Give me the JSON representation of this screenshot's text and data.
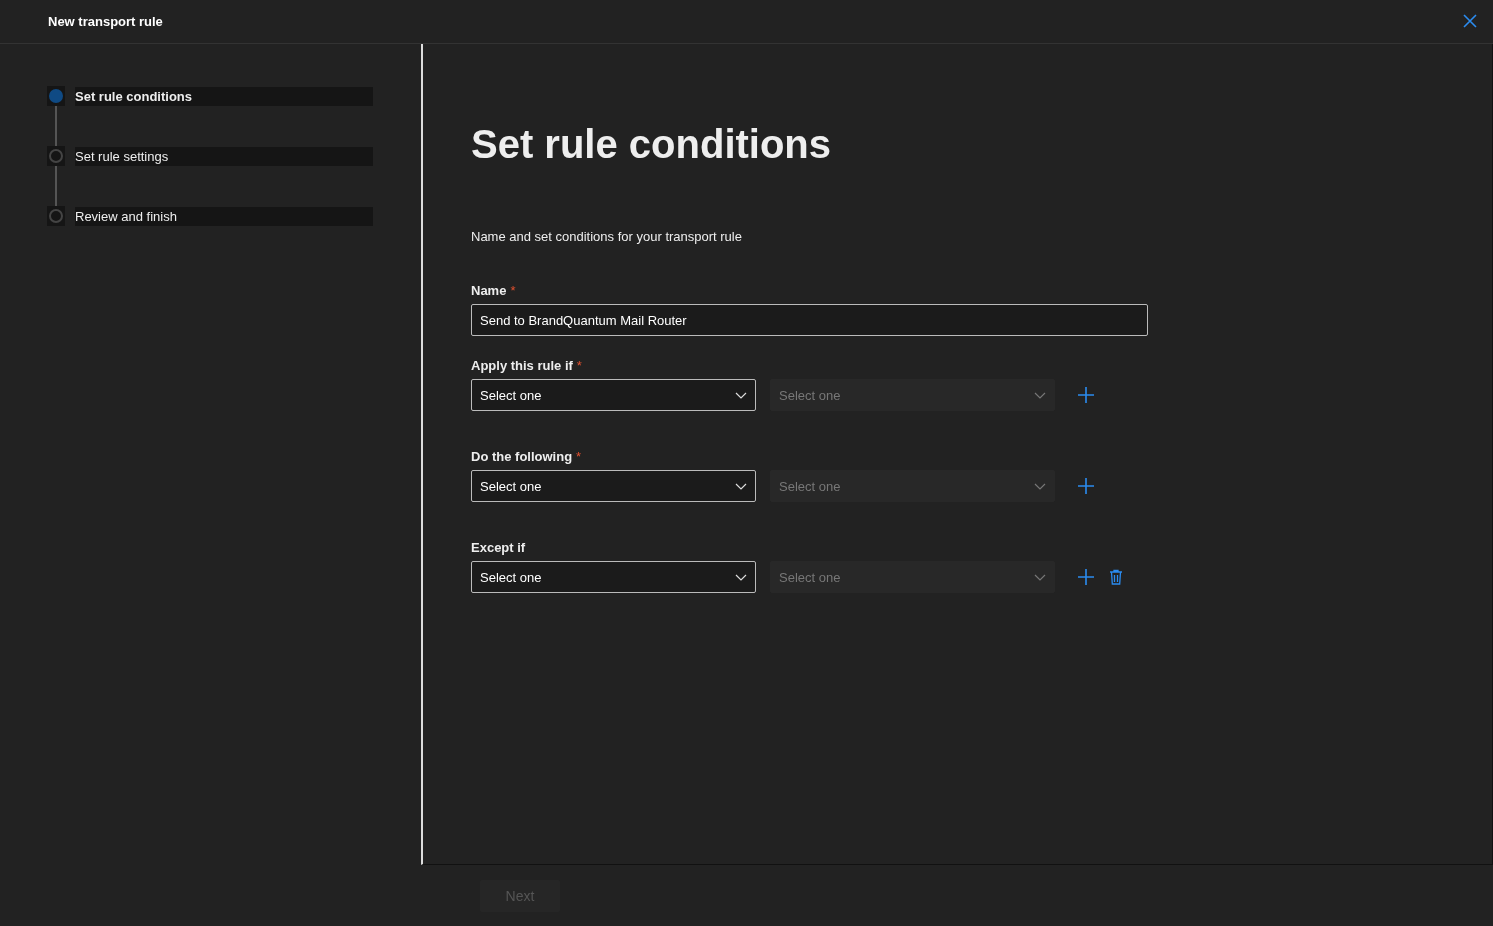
{
  "window": {
    "title": "New transport rule"
  },
  "steps": [
    {
      "label": "Set rule conditions",
      "selected": true
    },
    {
      "label": "Set rule settings",
      "selected": false
    },
    {
      "label": "Review and finish",
      "selected": false
    }
  ],
  "page": {
    "heading": "Set rule conditions",
    "description": "Name and set conditions for your transport rule"
  },
  "name_field": {
    "label": "Name",
    "required_mark": "*",
    "value": "Send to BrandQuantum Mail Router"
  },
  "condition_groups": [
    {
      "label": "Apply this rule if",
      "required_mark": "*",
      "primary": {
        "value": "Select one",
        "disabled": false
      },
      "secondary": {
        "value": "Select one",
        "disabled": true
      },
      "removable": false
    },
    {
      "label": "Do the following",
      "required_mark": "*",
      "primary": {
        "value": "Select one",
        "disabled": false
      },
      "secondary": {
        "value": "Select one",
        "disabled": true
      },
      "removable": false
    },
    {
      "label": "Except if",
      "primary": {
        "value": "Select one",
        "disabled": false
      },
      "secondary": {
        "value": "Select one",
        "disabled": true
      },
      "removable": true
    }
  ],
  "footer": {
    "next_button": {
      "label": "Next",
      "disabled": true
    }
  }
}
